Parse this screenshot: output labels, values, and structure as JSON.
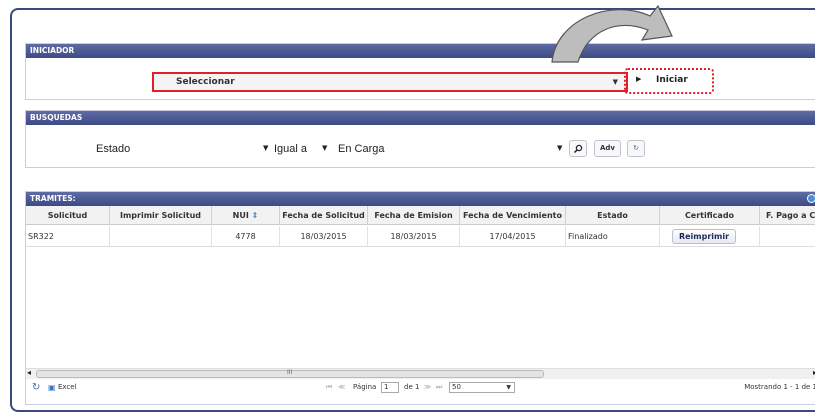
{
  "iniciador": {
    "header": "INICIADOR",
    "select_value": "Seleccionar",
    "iniciar_label": "Iniciar"
  },
  "busquedas": {
    "header": "BUSQUEDAS",
    "field": "Estado",
    "operator": "Igual a",
    "value": "En Carga",
    "adv_label": "Adv"
  },
  "tramites": {
    "header": "TRAMITES:",
    "columns": [
      "Solicitud",
      "Imprimir Solicitud",
      "NUI",
      "Fecha de Solicitud",
      "Fecha de Emision",
      "Fecha de Vencimiento",
      "Estado",
      "Certificado",
      "F. Pago a C"
    ],
    "rows": [
      {
        "solicitud": "SR322",
        "imprimir": "",
        "nui": "4778",
        "fecha_solicitud": "18/03/2015",
        "fecha_emision": "18/03/2015",
        "fecha_vencimiento": "17/04/2015",
        "estado": "Finalizado",
        "certificado": "Reimprimir"
      }
    ],
    "pager": {
      "excel_label": "Excel",
      "pagina_label": "Página",
      "page": "1",
      "de_label": "de 1",
      "page_size": "50",
      "mostrando": "Mostrando 1 - 1 de 1",
      "scroll_mid": "III"
    }
  }
}
